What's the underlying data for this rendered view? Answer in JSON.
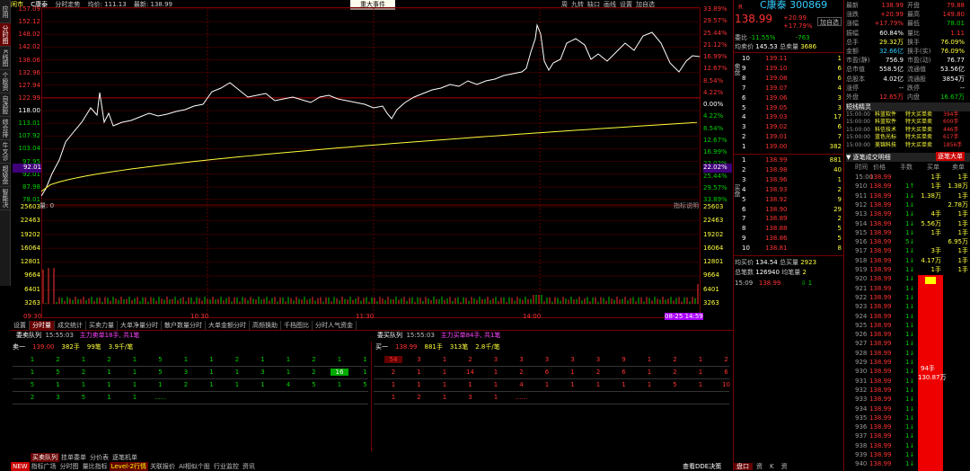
{
  "side_tabs": [
    "应用",
    "分时图",
    "K线图",
    "个股资料",
    "自选股",
    "综合排名",
    "牛叉诊股",
    "超级盘口",
    "智能决策"
  ],
  "topbar": {
    "market": "闲市",
    "stock": "C康泰",
    "mode": "分时走势",
    "avg": "均价: 111.13",
    "latest": "最新: 138.99"
  },
  "event_button": "重大事件",
  "toolbar": [
    "周",
    "九转",
    "缺口",
    "画线",
    "设置",
    "加自选"
  ],
  "y_left": [
    "157.09",
    "152.12",
    "148.02",
    "142.02",
    "138.06",
    "132.96",
    "127.94",
    "122.99",
    "118.00",
    "113.01",
    "107.92",
    "103.04",
    "97.95",
    "92.01",
    "87.98",
    "78.01"
  ],
  "y_right": [
    "33.89%",
    "29.57%",
    "25.44%",
    "21.12%",
    "16.99%",
    "12.67%",
    "8.54%",
    "4.22%",
    "0.00%",
    "4.22%",
    "8.54%",
    "12.67%",
    "16.99%",
    "22.02%",
    "25.44%",
    "29.57%",
    "33.89%"
  ],
  "vol_left": [
    "25603",
    "22463",
    "19202",
    "16064",
    "12801",
    "9664",
    "6401",
    "3263"
  ],
  "vol_right": [
    "25603",
    "22463",
    "19202",
    "16064",
    "12801",
    "9664",
    "6401",
    "3263"
  ],
  "vol_label": "量: 0",
  "vol_note": "指标说明",
  "x_times": [
    "09:30",
    "10:30",
    "11:30",
    "14:00",
    "08-25 14:59"
  ],
  "cur_price_tag": "92.01",
  "cur_pct_tag": "22.02%",
  "tabs": [
    "设置",
    "分时量",
    "成交统计",
    "买卖力量",
    "大单净量分时",
    "散户数量分时",
    "大单金额分时",
    "高频换助",
    "千档图比",
    "分时人气资金"
  ],
  "queue": {
    "title": "委卖队列",
    "time": "15:55:03",
    "note": "主力卖单18手, 共1笔",
    "title2": "委买队列",
    "time2": "15:55:03",
    "note2": "主力买单84手, 共1笔",
    "sell_head": [
      "卖一",
      "139.00",
      "382手",
      "99笔",
      "3.9千/笔"
    ],
    "buy_head": [
      "买一",
      "138.99",
      "881手",
      "313笔",
      "2.8千/笔"
    ],
    "sell_rows": [
      [
        "1",
        "2",
        "1",
        "2",
        "1",
        "5",
        "1",
        "1",
        "2",
        "1",
        "1",
        "2",
        "1",
        "1"
      ],
      [
        "1",
        "5",
        "2",
        "1",
        "1",
        "5",
        "3",
        "1",
        "1",
        "3",
        "1",
        "2",
        "16",
        "1"
      ],
      [
        "5",
        "1",
        "1",
        "1",
        "1",
        "1",
        "2",
        "1",
        "1",
        "1",
        "4",
        "5",
        "1",
        "5"
      ],
      [
        "2",
        "3",
        "5",
        "1",
        "1",
        "......",
        "",
        "",
        "",
        "",
        "",
        "",
        "",
        ""
      ]
    ],
    "buy_rows": [
      [
        "54",
        "3",
        "1",
        "2",
        "3",
        "3",
        "3",
        "3",
        "3",
        "9",
        "1",
        "2",
        "1",
        "2"
      ],
      [
        "2",
        "1",
        "1",
        "14",
        "1",
        "2",
        "6",
        "1",
        "2",
        "6",
        "1",
        "2",
        "1",
        "6"
      ],
      [
        "1",
        "1",
        "1",
        "1",
        "1",
        "4",
        "1",
        "1",
        "1",
        "1",
        "1",
        "5",
        "1",
        "10"
      ],
      [
        "1",
        "2",
        "1",
        "3",
        "1",
        "......",
        "",
        "",
        "",
        "",
        "",
        "",
        "",
        ""
      ]
    ]
  },
  "bottom_tabs": [
    "NEW",
    "指标广场",
    "分时图",
    "量比指标",
    "Level-2行情",
    "关联报价",
    "AI相似个股",
    "行业监控",
    "资讯"
  ],
  "bottom_tabs2": [
    "买卖队列",
    "挂单委单",
    "分价表",
    "逐笔机单"
  ],
  "bottom_right": "查看DDE决策",
  "quote": {
    "name": "C康泰 300869",
    "price": "138.99",
    "chg": "+20.99",
    "pct": "+17.79%",
    "add": "加自选",
    "ratio_label": "委比",
    "ratio": "-11.55%",
    "diff": "-763",
    "avg_label": "均卖价",
    "avg": "145.53",
    "total_label": "总卖量",
    "total": "3686",
    "asks": [
      [
        "10",
        "139.11",
        "1"
      ],
      [
        "9",
        "139.10",
        "6"
      ],
      [
        "8",
        "139.08",
        "6"
      ],
      [
        "7",
        "139.07",
        "4"
      ],
      [
        "6",
        "139.06",
        "3"
      ],
      [
        "5",
        "139.05",
        "3"
      ],
      [
        "4",
        "139.03",
        "17"
      ],
      [
        "3",
        "139.02",
        "6"
      ],
      [
        "2",
        "139.01",
        "7"
      ],
      [
        "1",
        "139.00",
        "382"
      ]
    ],
    "bids": [
      [
        "1",
        "138.99",
        "881"
      ],
      [
        "2",
        "138.98",
        "40"
      ],
      [
        "3",
        "138.96",
        "1"
      ],
      [
        "4",
        "138.93",
        "2"
      ],
      [
        "5",
        "138.92",
        "9"
      ],
      [
        "6",
        "138.90",
        "29"
      ],
      [
        "7",
        "138.89",
        "2"
      ],
      [
        "8",
        "138.88",
        "5"
      ],
      [
        "9",
        "138.86",
        "5"
      ],
      [
        "10",
        "138.81",
        "8"
      ]
    ],
    "ask_label": "卖盘",
    "bid_label": "买盘",
    "bavg_label": "均买价",
    "bavg": "134.54",
    "btotal_label": "总买量",
    "btotal": "2923",
    "cnt_label": "总笔数",
    "cnt": "126940",
    "jb_label": "均笔量",
    "jb": "2",
    "last_time": "15:09",
    "last_price": "138.99",
    "last_vol": "1"
  },
  "stats": [
    [
      "最新",
      "138.99",
      "开盘",
      "79.88"
    ],
    [
      "涨跌",
      "+20.99",
      "最高",
      "149.80"
    ],
    [
      "涨幅",
      "+17.79%",
      "最低",
      "78.01"
    ],
    [
      "振幅",
      "60.84%",
      "量比",
      "1.11"
    ],
    [
      "总手",
      "29.32万",
      "换手",
      "76.09%"
    ],
    [
      "金额",
      "32.66亿",
      "换手(实)",
      "76.09%"
    ],
    [
      "市盈(静)",
      "756.9",
      "市盈(动)",
      "76.77"
    ],
    [
      "总市值",
      "558.5亿",
      "流通值",
      "53.56亿"
    ],
    [
      "总股本",
      "4.02亿",
      "流通股",
      "3854万"
    ],
    [
      "涨停",
      "--",
      "跌停",
      "--"
    ],
    [
      "外盘",
      "12.65万",
      "内盘",
      "16.67万"
    ]
  ],
  "radar": {
    "title": "短线精灵",
    "rows": [
      [
        "15:00:00",
        "科蓝软件",
        "特大买单卖",
        "394手"
      ],
      [
        "15:00:00",
        "科蓝软件",
        "特大买单卖",
        "600手"
      ],
      [
        "15:00:00",
        "科信技术",
        "特大买单卖",
        "446手"
      ],
      [
        "15:00:00",
        "蓝色光标",
        "特大买单卖",
        "617手"
      ],
      [
        "15:00:00",
        "美锦科技",
        "特大买单卖",
        "1856手"
      ]
    ]
  },
  "ticks": {
    "title": "逐笔成交明细",
    "btn": "逐笔大单",
    "head": [
      "时间",
      "价格",
      "手数",
      "买单",
      "卖单"
    ],
    "rows": [
      [
        "15:00",
        "138.99",
        "",
        "1手",
        "1手"
      ],
      [
        "910",
        "138.99",
        "1↑",
        "1手",
        "1.38万"
      ],
      [
        "911",
        "138.99",
        "1↓",
        "1.38万",
        "1手"
      ],
      [
        "912",
        "138.99",
        "1↓",
        "",
        "2.78万"
      ],
      [
        "913",
        "138.99",
        "1↓",
        "4手",
        "1手"
      ],
      [
        "914",
        "138.99",
        "1↓",
        "5.56万",
        "1手"
      ],
      [
        "915",
        "138.99",
        "1↓",
        "1手",
        "1手"
      ],
      [
        "916",
        "138.99",
        "5↓",
        "",
        "6.95万"
      ],
      [
        "917",
        "138.99",
        "1↓",
        "3手",
        "1手"
      ],
      [
        "918",
        "138.99",
        "1↓",
        "4.17万",
        "1手"
      ],
      [
        "919",
        "138.99",
        "1↓",
        "1手",
        "1手"
      ],
      [
        "920",
        "138.99",
        "1↓",
        "",
        ""
      ],
      [
        "921",
        "138.99",
        "1↓",
        "",
        ""
      ],
      [
        "922",
        "138.99",
        "1↓",
        "",
        ""
      ],
      [
        "923",
        "138.99",
        "1↓",
        "",
        ""
      ],
      [
        "924",
        "138.99",
        "1↓",
        "",
        ""
      ],
      [
        "925",
        "138.99",
        "1↓",
        "",
        ""
      ],
      [
        "926",
        "138.99",
        "1↓",
        "",
        ""
      ],
      [
        "927",
        "138.99",
        "1↓",
        "",
        ""
      ],
      [
        "928",
        "138.99",
        "1↓",
        "",
        ""
      ],
      [
        "929",
        "138.99",
        "1↓",
        "",
        ""
      ],
      [
        "930",
        "138.99",
        "1↓",
        "",
        ""
      ],
      [
        "931",
        "138.99",
        "1↓",
        "",
        ""
      ],
      [
        "932",
        "138.99",
        "1↓",
        "",
        ""
      ],
      [
        "933",
        "138.99",
        "1↓",
        "",
        ""
      ],
      [
        "934",
        "138.99",
        "1↓",
        "",
        ""
      ],
      [
        "935",
        "138.99",
        "1↓",
        "",
        ""
      ],
      [
        "936",
        "138.99",
        "1↓",
        "",
        ""
      ],
      [
        "937",
        "138.99",
        "1↓",
        "",
        ""
      ],
      [
        "938",
        "138.99",
        "1↓",
        "",
        ""
      ],
      [
        "939",
        "138.99",
        "1↓",
        "",
        ""
      ],
      [
        "940",
        "138.99",
        "1↓",
        "",
        ""
      ]
    ],
    "bigbar": [
      "94手",
      "130.87万"
    ]
  },
  "bottom_rtabs": [
    "盘口",
    "资",
    "K",
    "资"
  ]
}
